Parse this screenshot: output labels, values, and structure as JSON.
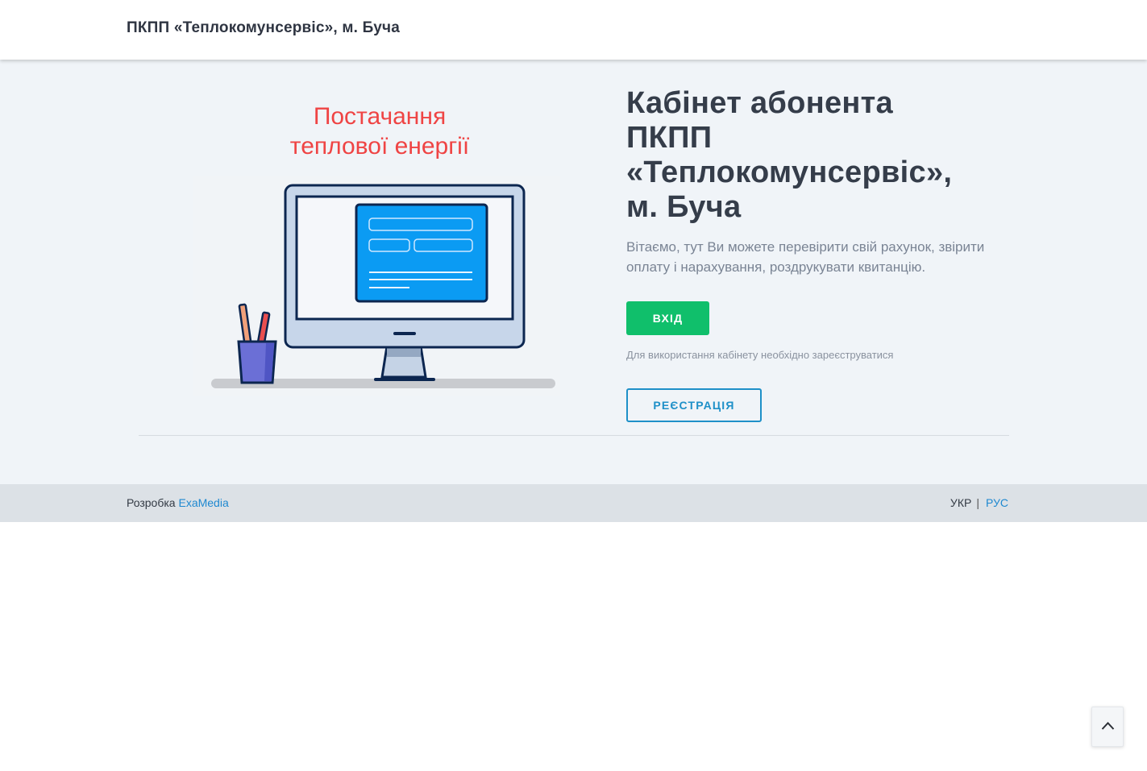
{
  "header": {
    "brand": "ПКПП «Теплокомунсервіс», м. Буча"
  },
  "hero": {
    "service_title_line1": "Постачання",
    "service_title_line2": "теплової енергії",
    "heading_line1": "Кабінет абонента",
    "heading_line2": "ПКПП",
    "heading_line3": "«Теплокомунсервіс»,",
    "heading_line4": "м. Буча",
    "lead": "Вітаємо, тут Ви можете перевірити свій рахунок, звірити оплату і нарахування, роздрукувати квитанцію.",
    "login_label": "ВХІД",
    "register_note": "Для використання кабінету необхідно зареєструватися",
    "register_label": "РЕЄСТРАЦІЯ"
  },
  "footer": {
    "credit_prefix": "Розробка",
    "credit_link": "ExaMedia",
    "lang_current": "УКР",
    "lang_separator": "|",
    "lang_other": "РУС"
  },
  "icons": {
    "scroll_top": "chevron-up-icon",
    "illustration": "monitor-illustration"
  },
  "colors": {
    "accent_red": "#ef4444",
    "login_green": "#10bf6b",
    "register_blue": "#1e90c8",
    "link_blue": "#1e88d0",
    "hero_bg": "#f0f4f8",
    "footer_bg": "#dce1e6"
  }
}
